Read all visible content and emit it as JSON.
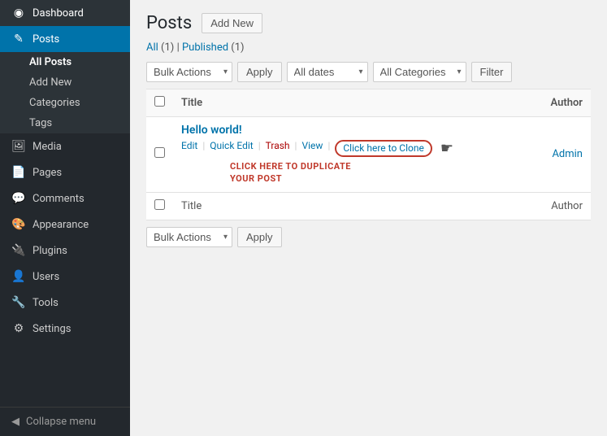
{
  "sidebar": {
    "logo": {
      "label": "Dashboard",
      "icon": "🏠"
    },
    "items": [
      {
        "id": "dashboard",
        "label": "Dashboard",
        "icon": "⊞",
        "active": false
      },
      {
        "id": "posts",
        "label": "Posts",
        "icon": "✎",
        "active": true
      },
      {
        "id": "media",
        "label": "Media",
        "icon": "🖼",
        "active": false
      },
      {
        "id": "pages",
        "label": "Pages",
        "icon": "📄",
        "active": false
      },
      {
        "id": "comments",
        "label": "Comments",
        "icon": "💬",
        "active": false
      },
      {
        "id": "appearance",
        "label": "Appearance",
        "icon": "🎨",
        "active": false
      },
      {
        "id": "plugins",
        "label": "Plugins",
        "icon": "🔌",
        "active": false
      },
      {
        "id": "users",
        "label": "Users",
        "icon": "👤",
        "active": false
      },
      {
        "id": "tools",
        "label": "Tools",
        "icon": "🔧",
        "active": false
      },
      {
        "id": "settings",
        "label": "Settings",
        "icon": "⚙",
        "active": false
      }
    ],
    "submenu_posts": [
      {
        "id": "all-posts",
        "label": "All Posts",
        "active": true
      },
      {
        "id": "add-new",
        "label": "Add New",
        "active": false
      },
      {
        "id": "categories",
        "label": "Categories",
        "active": false
      },
      {
        "id": "tags",
        "label": "Tags",
        "active": false
      }
    ],
    "collapse_label": "Collapse menu"
  },
  "header": {
    "title": "Posts",
    "add_new_label": "Add New"
  },
  "subnav": {
    "all_label": "All",
    "all_count": "(1)",
    "separator": "|",
    "published_label": "Published",
    "published_count": "(1)"
  },
  "toolbar_top": {
    "bulk_actions_label": "Bulk Actions",
    "apply_label": "Apply",
    "all_dates_label": "All dates",
    "all_categories_label": "All Categories",
    "filter_label": "Filter"
  },
  "table": {
    "col_title": "Title",
    "col_author": "Author",
    "rows": [
      {
        "id": "row-header-top",
        "title": "Title",
        "author": "Author"
      }
    ],
    "post": {
      "title": "Hello world!",
      "author": "Admin",
      "actions": {
        "edit": "Edit",
        "quick_edit": "Quick Edit",
        "trash": "Trash",
        "view": "View",
        "clone": "Click here to Clone"
      }
    },
    "footer_title": "Title",
    "footer_author": "Author"
  },
  "toolbar_bottom": {
    "bulk_actions_label": "Bulk Actions",
    "apply_label": "Apply"
  },
  "clone_callout": "CLICK HERE TO DUPLICATE\nYOUR POST"
}
